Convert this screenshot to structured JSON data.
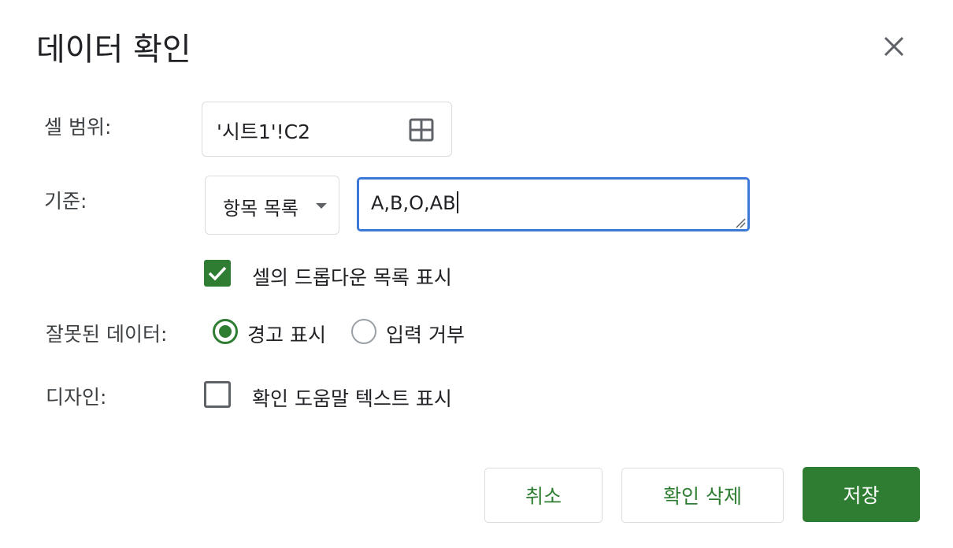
{
  "dialog": {
    "title": "데이터 확인"
  },
  "cell_range": {
    "label": "셀 범위:",
    "value": "'시트1'!C2",
    "icon": "grid-select-icon"
  },
  "criteria": {
    "label": "기준:",
    "type_selected": "항목 목록",
    "items_value": "A,B,O,AB"
  },
  "dropdown_option": {
    "label": "셀의 드롭다운 목록 표시",
    "checked": true
  },
  "invalid_data": {
    "label": "잘못된 데이터:",
    "options": [
      {
        "label": "경고 표시",
        "selected": true
      },
      {
        "label": "입력 거부",
        "selected": false
      }
    ]
  },
  "design": {
    "label": "디자인:",
    "help_text_option": "확인 도움말 텍스트 표시",
    "checked": false
  },
  "buttons": {
    "cancel": "취소",
    "remove": "확인 삭제",
    "save": "저장"
  },
  "colors": {
    "accent": "#2e7d32",
    "focus": "#3c78d8"
  }
}
